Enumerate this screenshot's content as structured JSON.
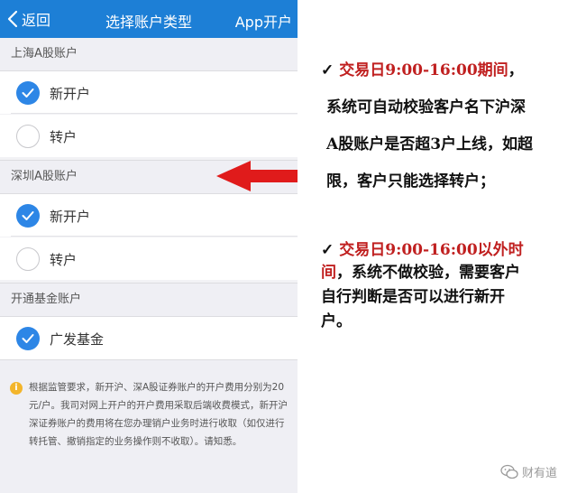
{
  "navbar": {
    "back_label": "返回",
    "title": "选择账户类型",
    "right_label": "App开户"
  },
  "sections": [
    {
      "header": "上海A股账户",
      "options": [
        {
          "label": "新开户",
          "checked": true
        },
        {
          "label": "转户",
          "checked": false
        }
      ]
    },
    {
      "header": "深圳A股账户",
      "options": [
        {
          "label": "新开户",
          "checked": true
        },
        {
          "label": "转户",
          "checked": false
        }
      ]
    },
    {
      "header": "开通基金账户",
      "options": [
        {
          "label": "广发基金",
          "checked": true
        }
      ]
    }
  ],
  "notice": {
    "icon": "info-icon",
    "icon_glyph": "i",
    "text": "根据监管要求，新开沪、深A股证券账户的开户费用分别为20元/户。我司对网上开户的开户费用采取后端收费模式，新开沪深证券账户的费用将在您办理销户业务时进行收取（如仅进行转托管、撤销指定的业务操作则不收取）。请知悉。"
  },
  "annotation": {
    "check_mark": "✓",
    "note1": {
      "line1_red": "交易日9:00-16:00期间",
      "line1_tail": "，",
      "line2": "系统可自动校验客户名下沪深",
      "line3": "A股账户是否超3户上线，如超",
      "line4": "限，客户只能选择转户；"
    },
    "note2": {
      "line1_red": "交易日9:00-16:00以外时",
      "line2_red": "间",
      "line2_tail": "，系统不做校验，需要客户",
      "line3": "自行判断是否可以进行新开",
      "line4": "户。"
    },
    "colors": {
      "highlight": "#c02020",
      "arrow": "#e01b1b",
      "accent": "#1d7fd6"
    }
  },
  "watermark": {
    "icon": "wechat-icon",
    "text": "财有道"
  }
}
